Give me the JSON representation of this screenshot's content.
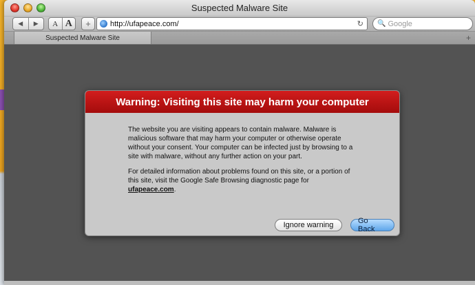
{
  "window": {
    "title": "Suspected Malware Site"
  },
  "toolbar": {
    "back_glyph": "◀",
    "forward_glyph": "▶",
    "font_small": "A",
    "font_large": "A",
    "add_glyph": "+",
    "url": "http://ufapeace.com/",
    "reload_glyph": "↻",
    "search_placeholder": "Google",
    "search_glyph": "🔍"
  },
  "tabs": [
    {
      "label": "Suspected Malware Site"
    }
  ],
  "tab_add_glyph": "+",
  "dialog": {
    "title": "Warning: Visiting this site may harm your computer",
    "paragraph1": "The website you are visiting appears to contain malware. Malware is malicious software that may harm your computer or otherwise operate without your consent. Your computer can be infected just by browsing to a site with malware, without any further action on your part.",
    "paragraph2_prefix": "For detailed information about problems found on this site, or a portion of this site, visit the Google Safe Browsing diagnostic page for ",
    "paragraph2_link": "ufapeace.com",
    "paragraph2_suffix": ".",
    "ignore_label": "Ignore warning",
    "goback_label": "Go Back"
  },
  "colors": {
    "warning_red": "#c01414",
    "content_bg": "#535353",
    "dialog_bg": "#c9c9c9",
    "go_back_blue": "#5fa6ea"
  }
}
